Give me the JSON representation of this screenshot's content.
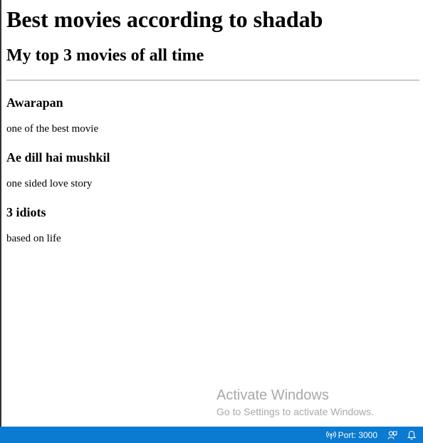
{
  "page": {
    "title": "Best movies according to shadab",
    "subtitle": "My top 3 movies of all time"
  },
  "movies": [
    {
      "title": "Awarapan",
      "description": "one of the best movie"
    },
    {
      "title": "Ae dill hai mushkil",
      "description": "one sided love story"
    },
    {
      "title": "3 idiots",
      "description": "based on life"
    }
  ],
  "watermark": {
    "title": "Activate Windows",
    "subtitle": "Go to Settings to activate Windows."
  },
  "statusbar": {
    "port_label": "Port: 3000",
    "background_color": "#0b7ad1",
    "icons": [
      "broadcast-icon",
      "feedback-icon",
      "bell-icon"
    ]
  }
}
